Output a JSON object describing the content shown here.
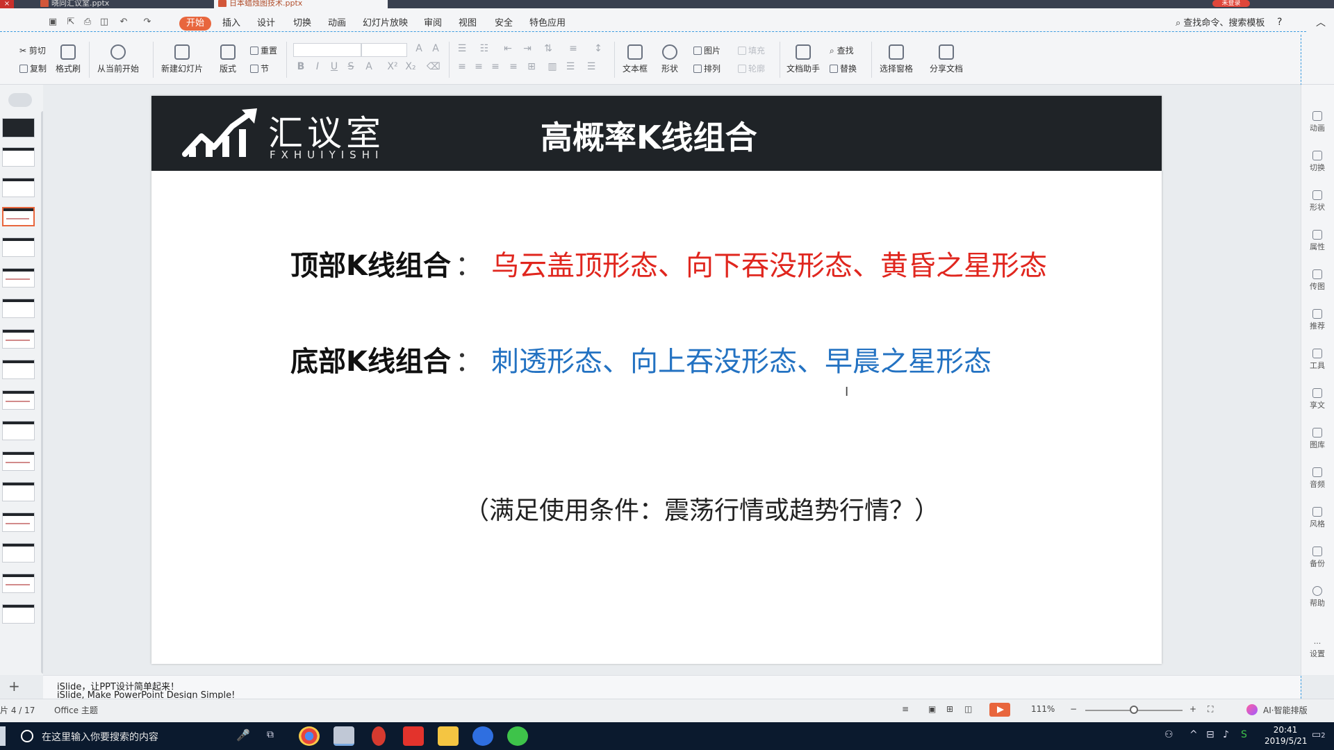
{
  "window": {
    "tabs": [
      {
        "label": "晓同汇议室.pptx",
        "active": false
      },
      {
        "label": "日本蜡烛图技术.pptx",
        "active": true
      }
    ],
    "login_label": "未登录"
  },
  "menu": {
    "tabs": [
      "开始",
      "插入",
      "设计",
      "切换",
      "动画",
      "幻灯片放映",
      "审阅",
      "视图",
      "安全",
      "特色应用"
    ],
    "active_tab": "开始",
    "search_label": "查找命令、搜索模板"
  },
  "ribbon": {
    "cut": "剪切",
    "copy": "复制",
    "format_painter": "格式刷",
    "from_current": "从当前开始",
    "new_slide": "新建幻灯片",
    "layout": "版式",
    "reset": "重置",
    "section": "节",
    "textbox": "文本框",
    "shape": "形状",
    "picture": "图片",
    "fill": "填充",
    "arrange": "排列",
    "outline": "轮廓",
    "find": "查找",
    "replace": "替换",
    "doc_assistant": "文档助手",
    "select_pane": "选择窗格",
    "share_doc": "分享文档"
  },
  "slide": {
    "logo_text": "汇议室",
    "logo_sub": "FXHUIYISHI",
    "title": "高概率K线组合",
    "top_label": "顶部K线组合",
    "top_items": "乌云盖顶形态、向下吞没形态、黄昏之星形态",
    "bottom_label": "底部K线组合",
    "bottom_items": "刺透形态、向上吞没形态、早晨之星形态",
    "colon": "：",
    "note": "（满足使用条件：震荡行情或趋势行情？）",
    "colors": {
      "header": "#1f2327",
      "top_items": "#e0261e",
      "bottom_items": "#2372c2"
    }
  },
  "right_pane": [
    "动画",
    "切换",
    "形状",
    "属性",
    "传图",
    "推荐",
    "工具",
    "享文",
    "图库",
    "音频",
    "风格",
    "备份",
    "帮助",
    "设置"
  ],
  "notes": {
    "line1": "iSlide，让PPT设计简单起来！",
    "line2": "iSlide, Make PowerPoint Design Simple!"
  },
  "status": {
    "slide_counter": "片 4 / 17",
    "theme": "Office 主题",
    "zoom": "111%",
    "ai_layout": "AI·智能排版"
  },
  "taskbar": {
    "search_placeholder": "在这里输入你要搜索的内容",
    "time": "20:41",
    "date": "2019/5/21",
    "notifications": "2"
  }
}
